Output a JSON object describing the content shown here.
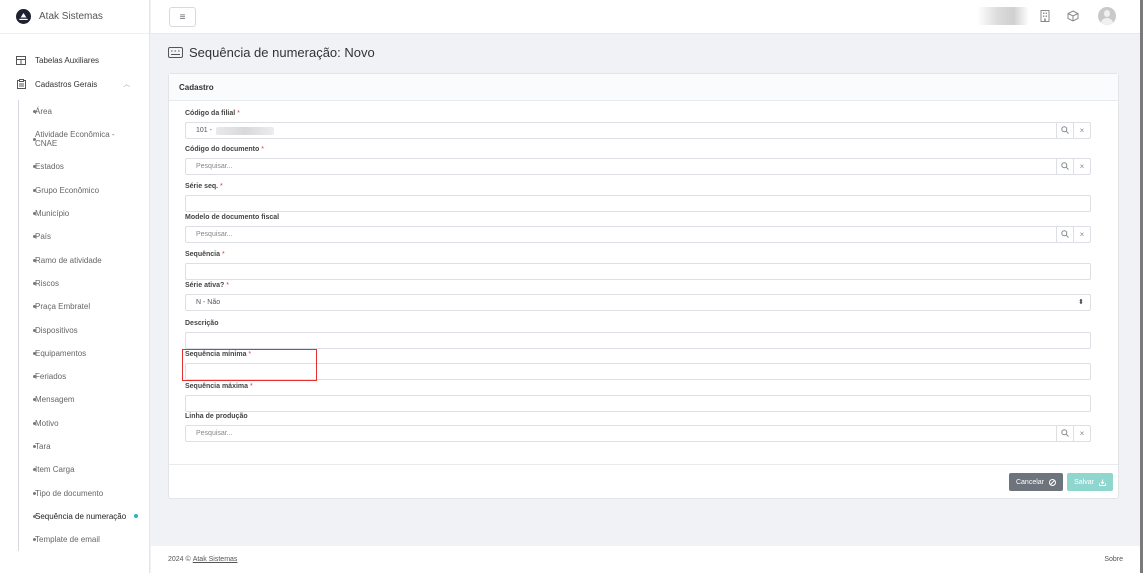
{
  "app": {
    "brand": "Atak Sistemas"
  },
  "sidebar": {
    "groups": [
      {
        "label": "Tabelas Auxiliares"
      },
      {
        "label": "Cadastros Gerais"
      }
    ],
    "items": [
      {
        "label": "Área"
      },
      {
        "label": "Atividade Econômica - CNAE"
      },
      {
        "label": "Estados"
      },
      {
        "label": "Grupo Econômico"
      },
      {
        "label": "Município"
      },
      {
        "label": "País"
      },
      {
        "label": "Ramo de atividade"
      },
      {
        "label": "Riscos"
      },
      {
        "label": "Praça Embratel"
      },
      {
        "label": "Dispositivos"
      },
      {
        "label": "Equipamentos"
      },
      {
        "label": "Feriados"
      },
      {
        "label": "Mensagem"
      },
      {
        "label": "Motivo"
      },
      {
        "label": "Tara"
      },
      {
        "label": "Item Carga"
      },
      {
        "label": "Tipo de documento"
      },
      {
        "label": "Sequência de numeração"
      },
      {
        "label": "Template de email"
      }
    ]
  },
  "page": {
    "title": "Sequência de numeração: Novo"
  },
  "card": {
    "title": "Cadastro"
  },
  "form": {
    "fields": [
      {
        "label": "Código da filial",
        "required": "*",
        "value": "101 -"
      },
      {
        "label": "Código do documento",
        "required": "*",
        "placeholder": "Pesquisar..."
      },
      {
        "label": "Série seq.",
        "required": "*",
        "value": ""
      },
      {
        "label": "Modelo de documento fiscal",
        "required": "",
        "placeholder": "Pesquisar..."
      },
      {
        "label": "Sequência",
        "required": "*",
        "value": ""
      },
      {
        "label": "Série ativa?",
        "required": "*",
        "value": "N - Não"
      },
      {
        "label": "Descrição",
        "required": "",
        "value": ""
      },
      {
        "label": "Sequência mínima",
        "required": "*",
        "value": ""
      },
      {
        "label": "Sequência máxima",
        "required": "*",
        "value": ""
      },
      {
        "label": "Linha de produção",
        "required": "",
        "placeholder": "Pesquisar..."
      }
    ],
    "cancel_label": "Cancelar",
    "save_label": "Salvar"
  },
  "footer": {
    "copyright": "2024 ©",
    "link": "Atak Sistemas",
    "about": "Sobre"
  },
  "colors": {
    "required": "#e03a3a",
    "cancel_bg": "#6d747c",
    "save_bg": "#8fd6cf",
    "active_dot": "#2bb3c0",
    "highlight": "#e53030"
  }
}
